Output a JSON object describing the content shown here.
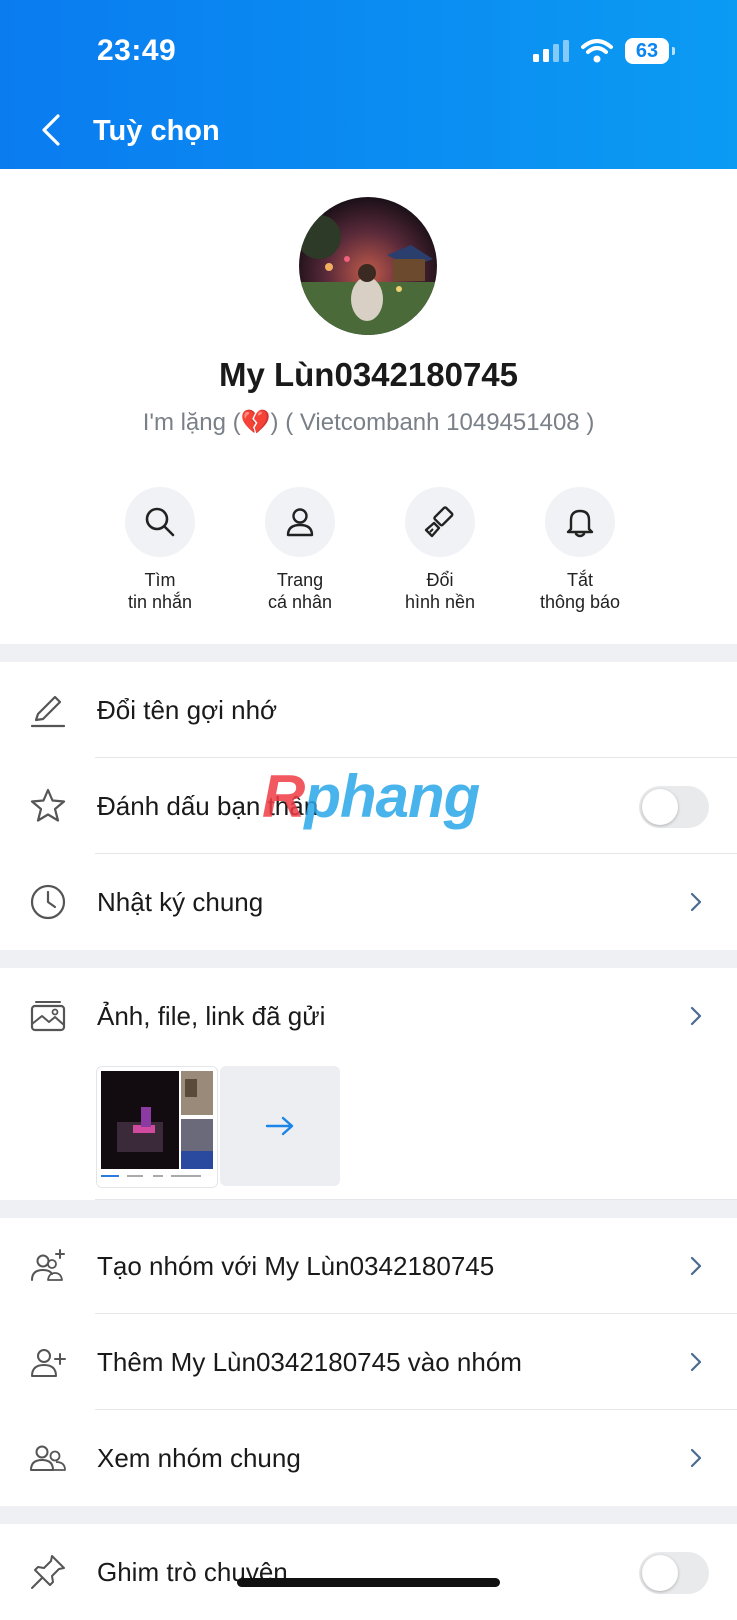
{
  "status_bar": {
    "time": "23:49",
    "battery": "63"
  },
  "header": {
    "title": "Tuỳ chọn"
  },
  "profile": {
    "name": "My Lùn0342180745",
    "status_prefix": "I'm lặng (",
    "status_emoji": "💔",
    "status_suffix": ") ( Vietcombanh 1049451408 )"
  },
  "quick_actions": [
    {
      "line1": "Tìm",
      "line2": "tin nhắn",
      "icon": "search-icon"
    },
    {
      "line1": "Trang",
      "line2": "cá nhân",
      "icon": "user-icon"
    },
    {
      "line1": "Đổi",
      "line2": "hình nền",
      "icon": "brush-icon"
    },
    {
      "line1": "Tắt",
      "line2": "thông báo",
      "icon": "bell-icon"
    }
  ],
  "menu": {
    "rename": "Đổi tên gợi nhớ",
    "best_friend": "Đánh dấu bạn thân",
    "diary": "Nhật ký chung",
    "media": "Ảnh, file, link đã gửi",
    "create_group": "Tạo nhóm với My Lùn0342180745",
    "add_to_group": "Thêm My Lùn0342180745 vào nhóm",
    "common_groups": "Xem nhóm chung",
    "pin_chat": "Ghim trò chuyện"
  },
  "toggles": {
    "best_friend": false,
    "pin_chat": false
  },
  "watermark": {
    "part1": "R",
    "part2": "phang"
  },
  "colors": {
    "header_start": "#0a7cf0",
    "header_end": "#0b9bf3",
    "accent": "#0b86f0"
  }
}
